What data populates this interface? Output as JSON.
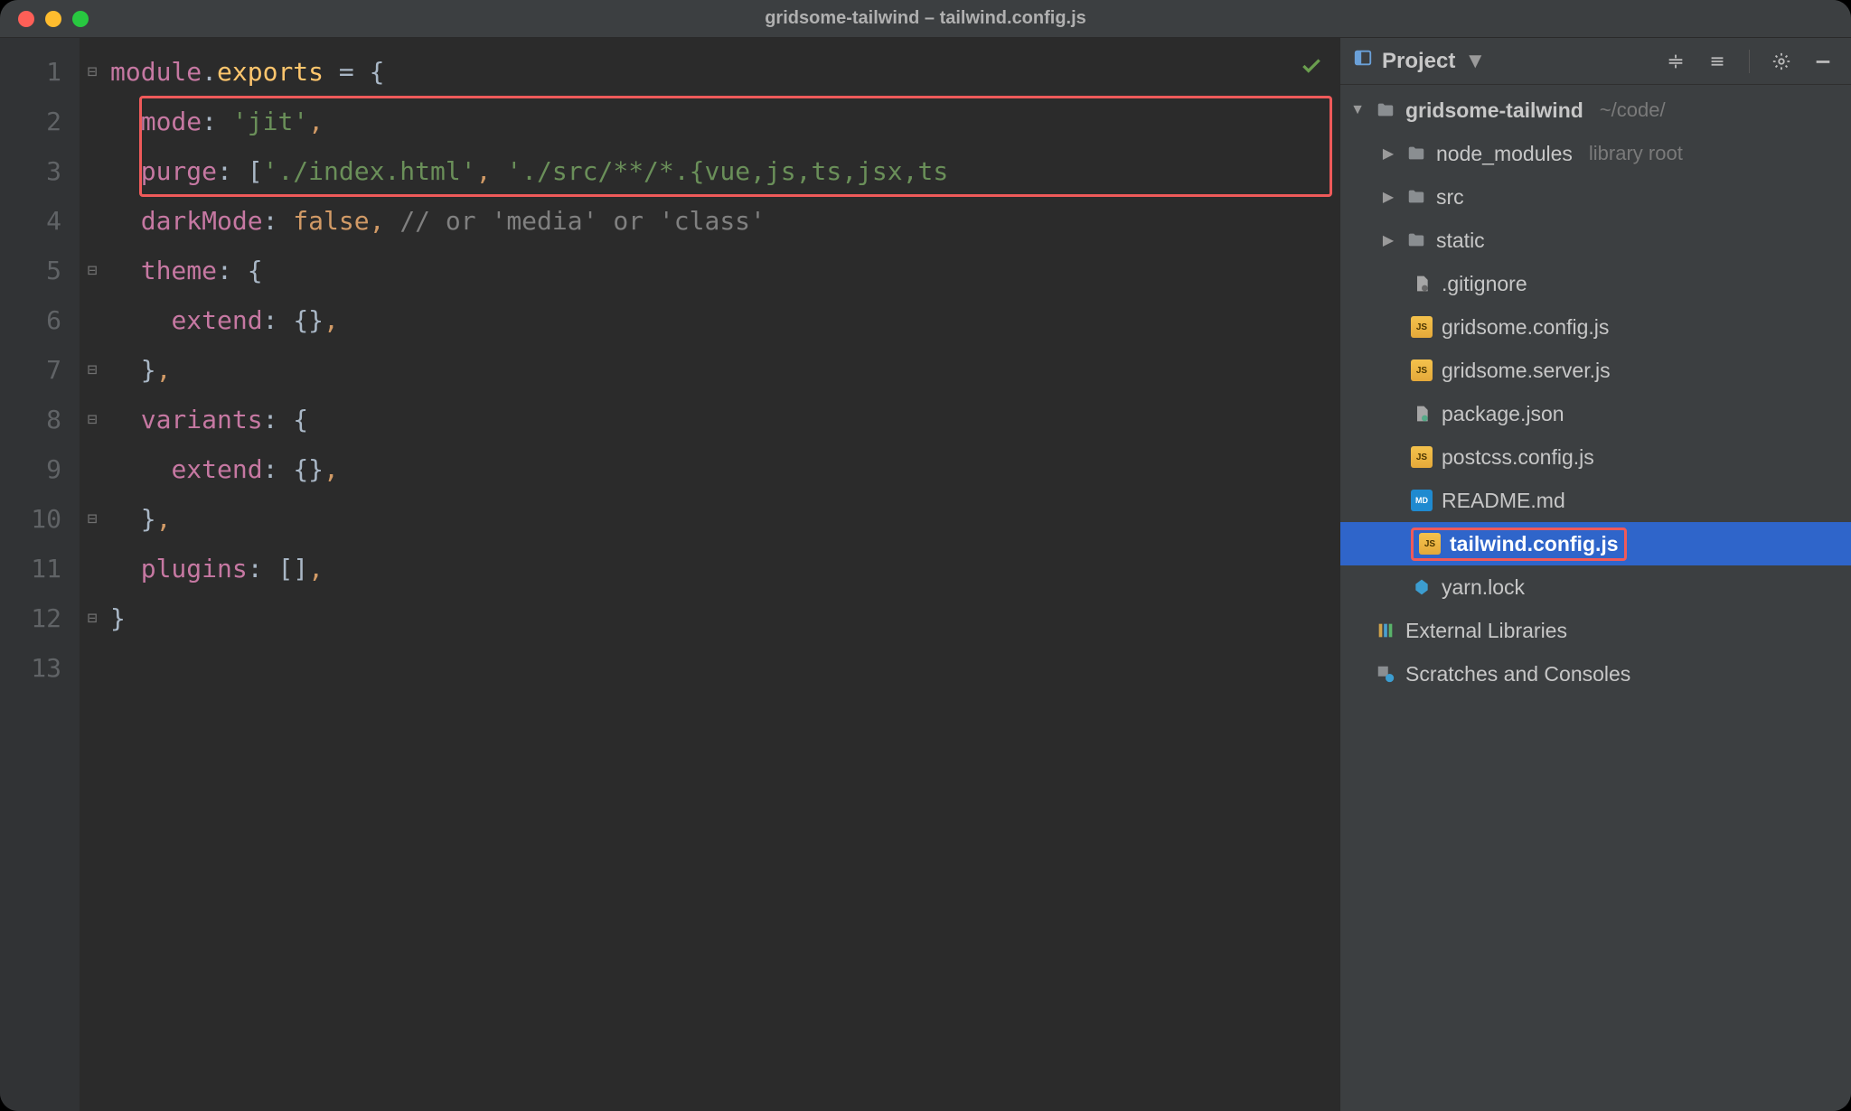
{
  "window": {
    "title": "gridsome-tailwind – tailwind.config.js"
  },
  "editor": {
    "line_numbers": [
      "1",
      "2",
      "3",
      "4",
      "5",
      "6",
      "7",
      "8",
      "9",
      "10",
      "11",
      "12",
      "13"
    ],
    "tokens": {
      "module": "module",
      "dot": ".",
      "exports": "exports",
      "equals": " = ",
      "lbrace": "{",
      "rbrace": "}",
      "mode_key": "mode",
      "mode_val": "'jit'",
      "purge_key": "purge",
      "purge_arr_open": "[",
      "purge_v1": "'./index.html'",
      "purge_v2": "'./src/**/*.{vue,js,ts,jsx,ts",
      "darkMode_key": "darkMode",
      "darkMode_val": "false",
      "dark_comment": "// or 'media' or 'class'",
      "theme_key": "theme",
      "extend_key": "extend",
      "empty_obj": "{}",
      "variants_key": "variants",
      "plugins_key": "plugins",
      "empty_arr": "[]",
      "colon": ": ",
      "comma": ",",
      "comma_sp": ", "
    }
  },
  "sidebar": {
    "header": {
      "label": "Project"
    },
    "tree": {
      "root": {
        "name": "gridsome-tailwind",
        "path": "~/code/"
      },
      "folders": [
        {
          "name": "node_modules",
          "note": "library root"
        },
        {
          "name": "src"
        },
        {
          "name": "static"
        }
      ],
      "files": [
        {
          "name": ".gitignore",
          "kind": "txt"
        },
        {
          "name": "gridsome.config.js",
          "kind": "js"
        },
        {
          "name": "gridsome.server.js",
          "kind": "js"
        },
        {
          "name": "package.json",
          "kind": "txt"
        },
        {
          "name": "postcss.config.js",
          "kind": "js"
        },
        {
          "name": "README.md",
          "kind": "md"
        },
        {
          "name": "tailwind.config.js",
          "kind": "js",
          "selected": true
        },
        {
          "name": "yarn.lock",
          "kind": "lock"
        }
      ],
      "extras": [
        {
          "name": "External Libraries",
          "kind": "lib"
        },
        {
          "name": "Scratches and Consoles",
          "kind": "scratch"
        }
      ]
    }
  }
}
